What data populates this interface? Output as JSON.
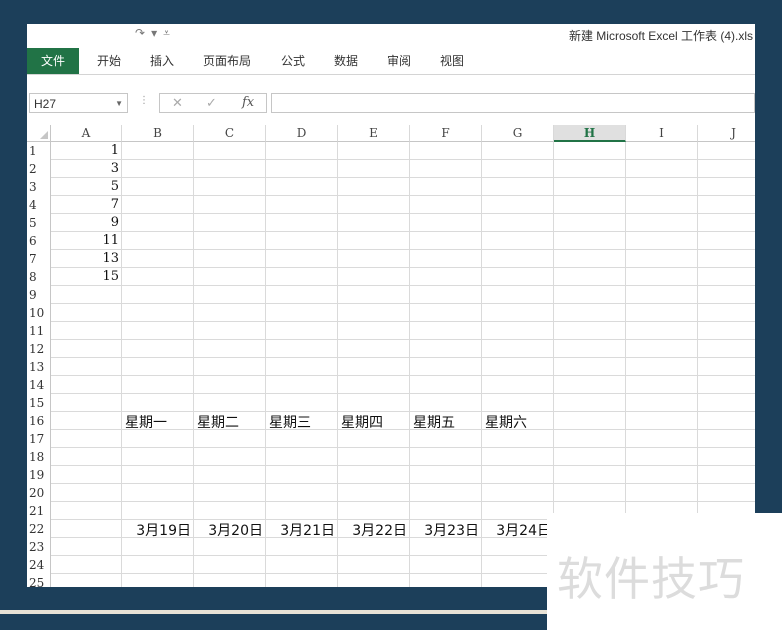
{
  "window": {
    "title": "新建 Microsoft Excel 工作表 (4).xls"
  },
  "qat": {
    "redo_icon": "↷",
    "dropdown_icon": "▾",
    "more_icon": "⩡"
  },
  "ribbon": {
    "tabs": [
      "文件",
      "开始",
      "插入",
      "页面布局",
      "公式",
      "数据",
      "审阅",
      "视图"
    ]
  },
  "formula_bar": {
    "name_box": "H27",
    "cancel": "✕",
    "enter": "✓",
    "fx": "fx",
    "value": ""
  },
  "columns": [
    "A",
    "B",
    "C",
    "D",
    "E",
    "F",
    "G",
    "H",
    "I",
    "J"
  ],
  "selected_column": "H",
  "rows": [
    "1",
    "2",
    "3",
    "4",
    "5",
    "6",
    "7",
    "8",
    "9",
    "10",
    "11",
    "12",
    "13",
    "14",
    "15",
    "16",
    "17",
    "18",
    "19",
    "20",
    "21",
    "22",
    "23",
    "24",
    "25"
  ],
  "cells": {
    "A": [
      "1",
      "3",
      "5",
      "7",
      "9",
      "11",
      "13",
      "15"
    ],
    "row16": [
      "星期一",
      "星期二",
      "星期三",
      "星期四",
      "星期五",
      "星期六"
    ],
    "row22": [
      "3月19日",
      "3月20日",
      "3月21日",
      "3月22日",
      "3月23日",
      "3月24日"
    ]
  },
  "watermark": "软件技巧"
}
